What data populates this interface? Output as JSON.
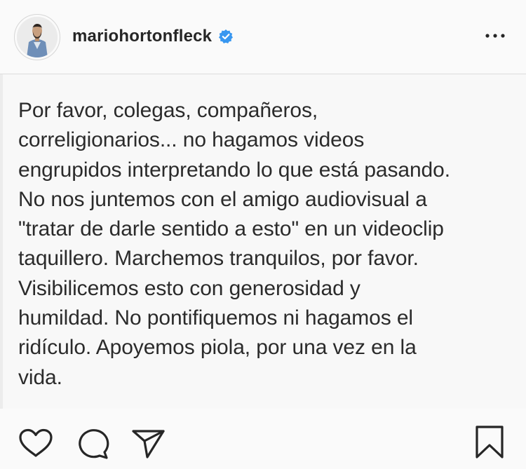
{
  "post": {
    "username": "mariohortonfleck",
    "verified": true,
    "media_text": "Por favor, colegas, compañeros,\ncorreligionarios... no hagamos videos\nengrupidos interpretando lo que está pasando.\nNo nos juntemos con el amigo audiovisual a\n\"tratar de darle sentido a esto\" en un videoclip\ntaquillero. Marchemos tranquilos, por favor.\nVisibilicemos esto con generosidad y\nhumildad. No pontifiquemos ni hagamos el\nridículo. Apoyemos piola, por una vez en la\nvida."
  },
  "icons": {
    "verified": "verified-badge-icon",
    "more": "more-options-icon",
    "like": "heart-icon",
    "comment": "comment-icon",
    "share": "send-icon",
    "save": "bookmark-icon"
  },
  "colors": {
    "text": "#262626",
    "verified_blue": "#3897f0",
    "background": "#fafafa"
  }
}
